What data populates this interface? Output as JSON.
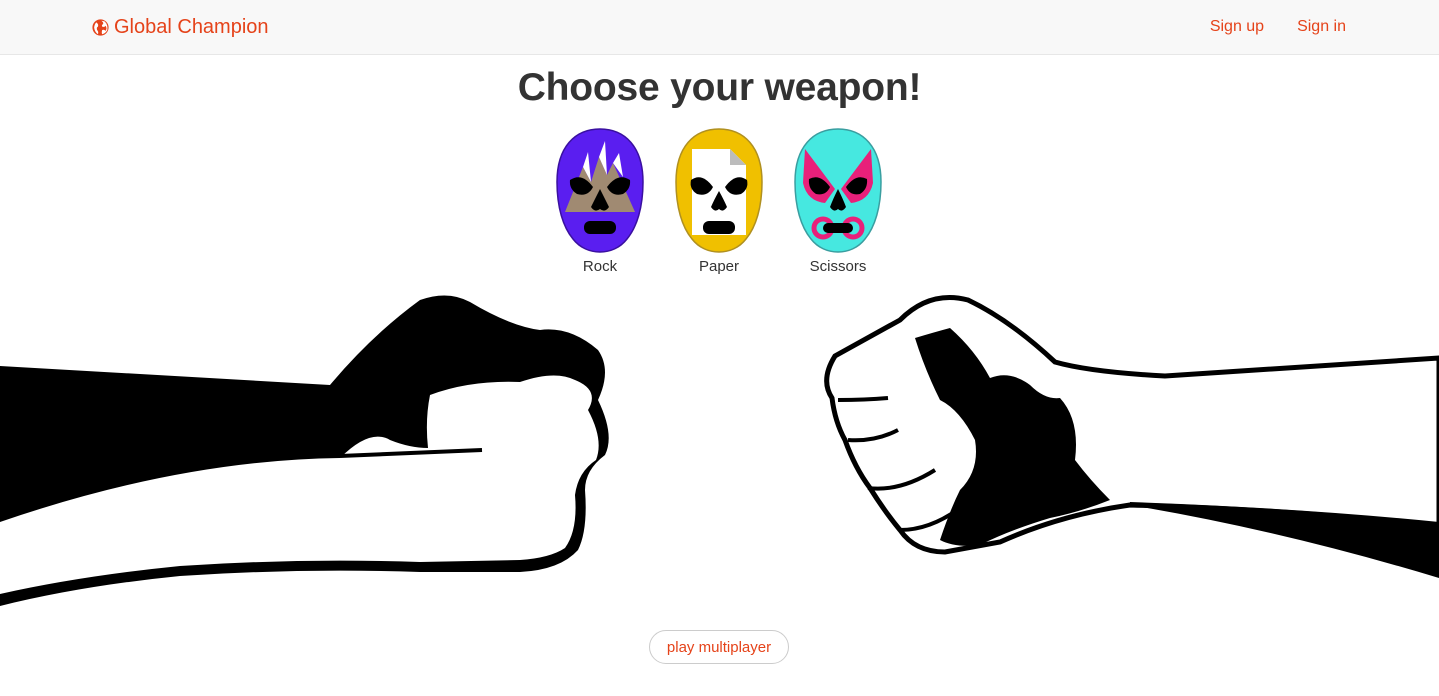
{
  "nav": {
    "brand": "Global Champion",
    "brand_icon": "globe-icon",
    "links": [
      {
        "label": "Sign up"
      },
      {
        "label": "Sign in"
      }
    ]
  },
  "main": {
    "heading": "Choose your weapon!",
    "weapons": [
      {
        "label": "Rock",
        "icon": "rock-mask-icon",
        "color": "#5a1ef0"
      },
      {
        "label": "Paper",
        "icon": "paper-mask-icon",
        "color": "#f0c000"
      },
      {
        "label": "Scissors",
        "icon": "scissors-mask-icon",
        "color": "#46e8e0"
      }
    ],
    "multiplayer_label": "play multiplayer"
  },
  "colors": {
    "accent": "#e5431a",
    "text": "#333333",
    "navbar_bg": "#f8f8f8"
  }
}
